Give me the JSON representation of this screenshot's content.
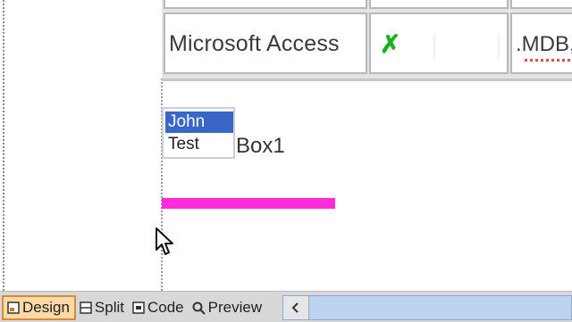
{
  "table": {
    "row_label": "Microsoft Access",
    "supported_icon": "check-mark-icon",
    "extension": ".MDB,"
  },
  "listbox": {
    "items": [
      "John",
      "Test"
    ],
    "selected_index": 0,
    "label": "Box1"
  },
  "view_tabs": [
    {
      "label": "Design",
      "icon": "design-icon",
      "active": true
    },
    {
      "label": "Split",
      "icon": "split-icon",
      "active": false
    },
    {
      "label": "Code",
      "icon": "code-icon",
      "active": false
    },
    {
      "label": "Preview",
      "icon": "preview-icon",
      "active": false
    }
  ],
  "colors": {
    "selection": "#3a66c8",
    "rule_bar": "#ff2bd8",
    "check": "#19b21e",
    "active_tab": "#ffd9a6"
  }
}
